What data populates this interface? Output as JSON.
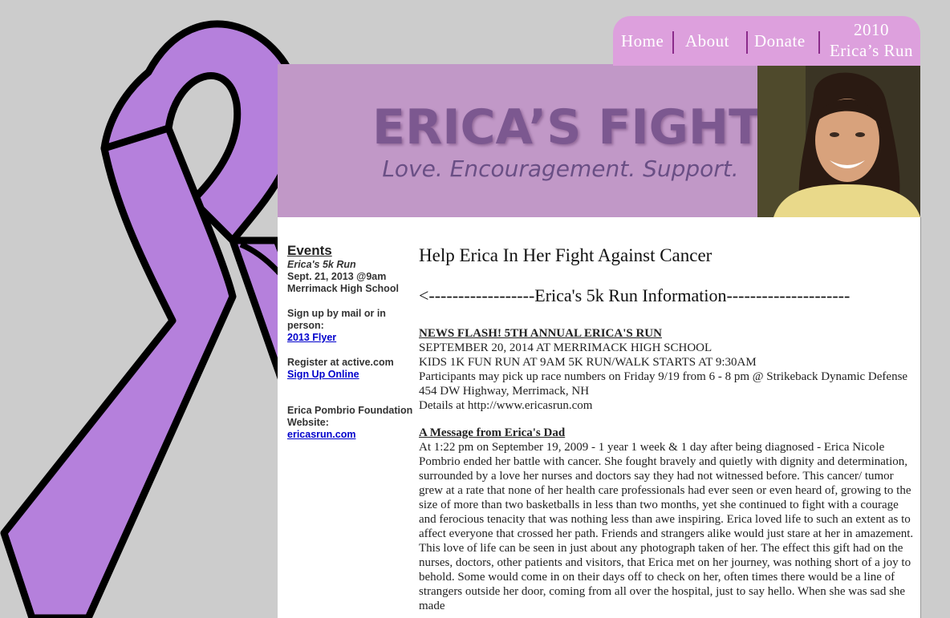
{
  "nav": {
    "items": [
      "Home",
      "About",
      "Donate"
    ],
    "run_line1": "2010",
    "run_line2": "Erica’s Run"
  },
  "header": {
    "logo_title": "ERICA’S FIGHT",
    "tagline": "Love. Encouragement. Support."
  },
  "sidebar": {
    "events_title": "Events",
    "run_name": "Erica's 5k Run",
    "run_date": "Sept. 21, 2013 @9am",
    "run_location": "Merrimack High School",
    "signup_text": "Sign up by mail or in person:",
    "flyer_link": "2013 Flyer",
    "register_text": "Register at active.com",
    "signup_link": "Sign Up Online",
    "foundation_text": "Erica Pombrio Foundation Website:",
    "foundation_link": "ericasrun.com"
  },
  "main": {
    "title": "Help Erica In Her Fight Against Cancer",
    "run_info_heading": "<------------------Erica's 5k Run Information---------------------",
    "news": {
      "title": "NEWS FLASH! 5TH ANNUAL ERICA'S RUN",
      "line1": "SEPTEMBER 20, 2014 AT MERRIMACK HIGH SCHOOL",
      "line2": "KIDS 1K FUN RUN AT 9AM 5K RUN/WALK STARTS AT 9:30AM",
      "line3": "Participants may pick up race numbers on Friday 9/19 from 6 - 8 pm @ Strikeback Dynamic Defense 454 DW Highway, Merrimack, NH",
      "line4": "Details at http://www.ericasrun.com"
    },
    "dad": {
      "title": "A Message from Erica's Dad",
      "body": "At 1:22 pm on September 19, 2009 - 1 year 1 week & 1 day after being diagnosed - Erica Nicole Pombrio ended her battle with cancer. She fought bravely and quietly with dignity and determination, surrounded by a love her nurses and doctors say they had not witnessed before. This cancer/ tumor grew at a rate that none of her health care professionals had ever seen or even heard of, growing to the size of more than two basketballs in less than two months, yet she continued to fight with a courage and ferocious tenacity that was nothing less than awe inspiring. Erica loved life to such an extent as to affect everyone that crossed her path. Friends and strangers alike would just stare at her in amazement. This love of life can be seen in just about any photograph taken of her. The effect this gift had on the nurses, doctors, other patients and visitors, that Erica met on her journey, was nothing short of a joy to behold. Some would come in on their days off to check on her, often times there would be a line of strangers outside her door, coming from all over the hospital, just to say hello. When she was sad she made"
    }
  },
  "colors": {
    "background": "#cccccc",
    "ribbon": "#b580dc",
    "nav_bg": "#dda0dd",
    "header_bg": "#c198c7",
    "logo": "#7c5890",
    "link": "#0000cc"
  }
}
